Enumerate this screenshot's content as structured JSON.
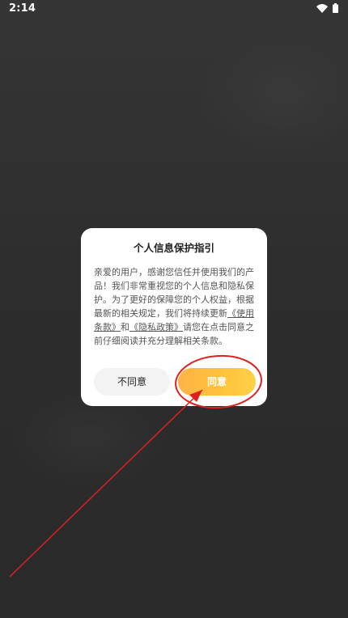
{
  "status_bar": {
    "time": "2:14",
    "icons": [
      "wifi-icon",
      "battery-icon"
    ]
  },
  "dialog": {
    "title": "个人信息保护指引",
    "body_prefix": "亲爱的用户，感谢您信任并使用我们的产品！我们非常重视您的个人信息和隐私保护。为了更好的保障您的个人权益，根据最新的相关规定，我们将持续更新",
    "terms_link": "《使用条款》",
    "and_text": "和",
    "privacy_link": "《隐私政策》",
    "body_suffix": "请您在点击同意之前仔细阅读并充分理解相关条款。",
    "disagree_label": "不同意",
    "agree_label": "同意"
  },
  "colors": {
    "background": "#2f2f2f",
    "agree_gradient_start": "#ffb347",
    "agree_gradient_end": "#ffd04a",
    "annotation": "#e02020"
  }
}
